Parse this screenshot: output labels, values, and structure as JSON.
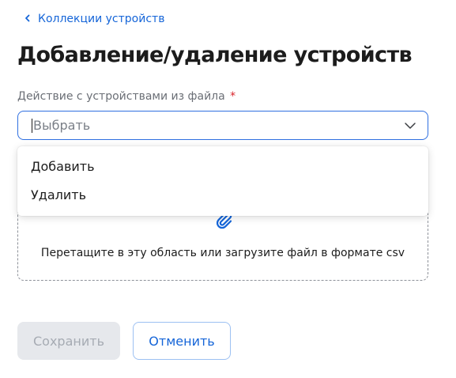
{
  "breadcrumb": {
    "back_label": "Коллекции устройств"
  },
  "page": {
    "title": "Добавление/удаление устройств"
  },
  "form": {
    "action_label": "Действие с устройствами из файла",
    "required_mark": "*",
    "select_placeholder": "Выбрать",
    "options": [
      {
        "label": "Добавить"
      },
      {
        "label": "Удалить"
      }
    ],
    "upload_hint": "Перетащите в эту область или загрузите файл в формате csv"
  },
  "actions": {
    "save_label": "Сохранить",
    "cancel_label": "Отменить"
  },
  "icons": {
    "back": "chevron-left-icon",
    "select": "chevron-down-icon",
    "upload": "paperclip-icon"
  },
  "colors": {
    "accent": "#1565d8",
    "focus_border": "#2f6fe0",
    "required": "#d8232a",
    "disabled_bg": "#e6e8ec"
  }
}
